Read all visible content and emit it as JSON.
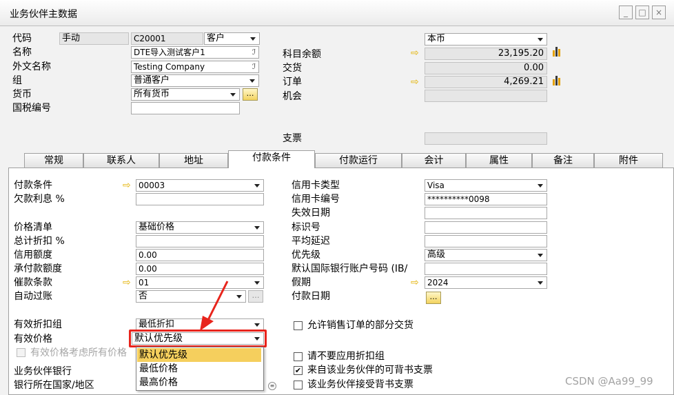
{
  "window": {
    "title": "业务伙伴主数据",
    "minimize": "_",
    "maximize": "□",
    "close": "×"
  },
  "header": {
    "code_label": "代码",
    "code_mode": "手动",
    "code_value": "C20001",
    "type_value": "客户",
    "name_label": "名称",
    "name_value": "DTE导入测试客户1",
    "foreign_name_label": "外文名称",
    "foreign_name_value": "Testing Company",
    "group_label": "组",
    "group_value": "普通客户",
    "currency_label": "货币",
    "currency_value": "所有货币",
    "tax_label": "国税编号",
    "tax_value": "",
    "local_currency": "本币",
    "account_balance_label": "科目余额",
    "account_balance": "23,195.20",
    "delivery_label": "交货",
    "delivery": "0.00",
    "orders_label": "订单",
    "orders": "4,269.21",
    "opportunities_label": "机会",
    "opportunities": "",
    "checks_label": "支票",
    "checks": ""
  },
  "tabs": [
    "常规",
    "联系人",
    "地址",
    "付款条件",
    "付款运行",
    "会计",
    "属性",
    "备注",
    "附件"
  ],
  "left": {
    "payment_terms_label": "付款条件",
    "payment_terms": "00003",
    "interest_label": "欠款利息 %",
    "interest": "",
    "price_list_label": "价格清单",
    "price_list": "基础价格",
    "total_discount_label": "总计折扣 %",
    "total_discount": "",
    "credit_limit_label": "信用额度",
    "credit_limit": "0.00",
    "commitment_limit_label": "承付款额度",
    "commitment_limit": "0.00",
    "dunning_label": "催款条款",
    "dunning": "01",
    "auto_post_label": "自动过账",
    "auto_post": "否",
    "eff_discount_label": "有效折扣组",
    "eff_discount": "最低折扣",
    "eff_price_label": "有效价格",
    "eff_price": "默认优先级",
    "eff_price_all_label": "有效价格考虑所有价格",
    "bank_label": "业务伙伴银行",
    "bank_country_label": "银行所在国家/地区"
  },
  "right": {
    "card_type_label": "信用卡类型",
    "card_type": "Visa",
    "card_no_label": "信用卡编号",
    "card_no": "**********0098",
    "expiry_label": "失效日期",
    "expiry": "",
    "id_label": "标识号",
    "id": "",
    "avg_delay_label": "平均延迟",
    "avg_delay": "",
    "priority_label": "优先级",
    "priority": "高级",
    "iban_label": "默认国际银行账户号码 (IB/",
    "iban": "",
    "holiday_label": "假期",
    "holiday": "2024",
    "pay_dates_label": "付款日期",
    "partial_delivery_label": "允许销售订单的部分交货",
    "partial_delivery": false,
    "no_discount_label": "请不要应用折扣组",
    "no_discount": false,
    "endorsed_from_label": "来自该业务伙伴的可背书支票",
    "endorsed_from": true,
    "accepts_endorsed_label": "该业务伙伴接受背书支票",
    "accepts_endorsed": false
  },
  "dropdown": {
    "options": [
      "默认优先级",
      "最低价格",
      "最高价格"
    ],
    "selected": "默认优先级"
  },
  "watermark": "CSDN @Aa99_99",
  "colors": {
    "highlight_red": "#e8241c",
    "menu_selected": "#f5cf5d",
    "arrow_yellow": "#e3b200"
  }
}
